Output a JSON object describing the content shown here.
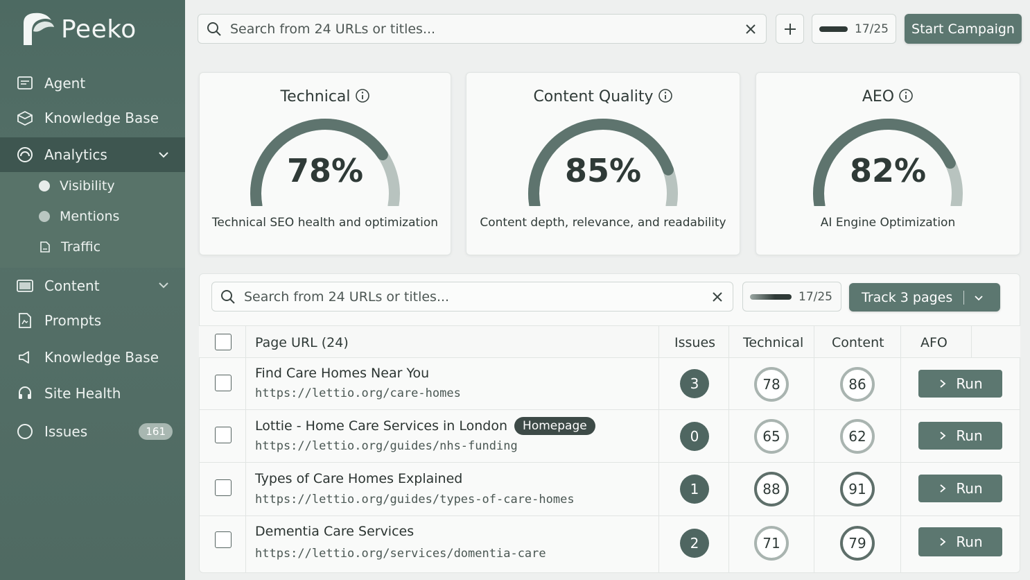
{
  "brand": {
    "name": "Peeko"
  },
  "sidebar": {
    "items": [
      {
        "label": "Agent",
        "icon": "message-square-icon"
      },
      {
        "label": "Knowledge Base",
        "icon": "box-icon"
      },
      {
        "label": "Analytics",
        "icon": "gauge-icon",
        "active": true,
        "expanded": true
      },
      {
        "label": "Content",
        "icon": "image-folder-icon"
      },
      {
        "label": "Prompts",
        "icon": "document-icon"
      },
      {
        "label": "Knowledge Base",
        "icon": "megaphone-icon"
      },
      {
        "label": "Site Health",
        "icon": "headset-icon"
      },
      {
        "label": "Issues",
        "icon": "circle-icon",
        "badge": "161"
      }
    ],
    "analytics_sub": [
      {
        "label": "Visibility",
        "icon": "dot-icon"
      },
      {
        "label": "Mentions",
        "icon": "dot-icon"
      },
      {
        "label": "Traffic",
        "icon": "page-icon"
      }
    ]
  },
  "topbar": {
    "search_placeholder": "Search from 24 URLs or titles...",
    "usage": "17/25",
    "usage_fraction": 0.68,
    "cta": "Start Campaign"
  },
  "scores": [
    {
      "title": "Technical",
      "value": "78%",
      "value_num": 78,
      "desc": "Technical SEO health and optimization"
    },
    {
      "title": "Content Quality",
      "value": "85%",
      "value_num": 85,
      "desc": "Content depth, relevance, and readability"
    },
    {
      "title": "AEO",
      "value": "82%",
      "value_num": 82,
      "desc": "AI Engine Optimization"
    }
  ],
  "table": {
    "search_placeholder": "Search from 24 URLs or titles...",
    "usage": "17/25",
    "track_button": "Track 3 pages",
    "columns": [
      "Page URL (24)",
      "Issues",
      "Technical",
      "Content",
      "AFO"
    ],
    "run_label": "Run",
    "rows": [
      {
        "title": "Find Care Homes Near You",
        "url": "https://lettio.org/care-homes",
        "tag": "",
        "issues": "3",
        "technical": "78",
        "content": "86"
      },
      {
        "title": "Lottie - Home Care Services in London",
        "url": "https://lettio.org/guides/nhs-funding",
        "tag": "Homepage",
        "issues": "0",
        "technical": "65",
        "content": "62"
      },
      {
        "title": "Types of Care Homes Explained",
        "url": "https://lettio.org/guides/types-of-care-homes",
        "tag": "",
        "issues": "1",
        "technical": "88",
        "content": "91"
      },
      {
        "title": "Dementia Care Services",
        "url": "https://lettio.org/services/domentia-care",
        "tag": "",
        "issues": "2",
        "technical": "71",
        "content": "79"
      }
    ]
  },
  "colors": {
    "sidebar": "#4f6a62",
    "accent": "#5c7770",
    "gauge": "#5e746e"
  }
}
